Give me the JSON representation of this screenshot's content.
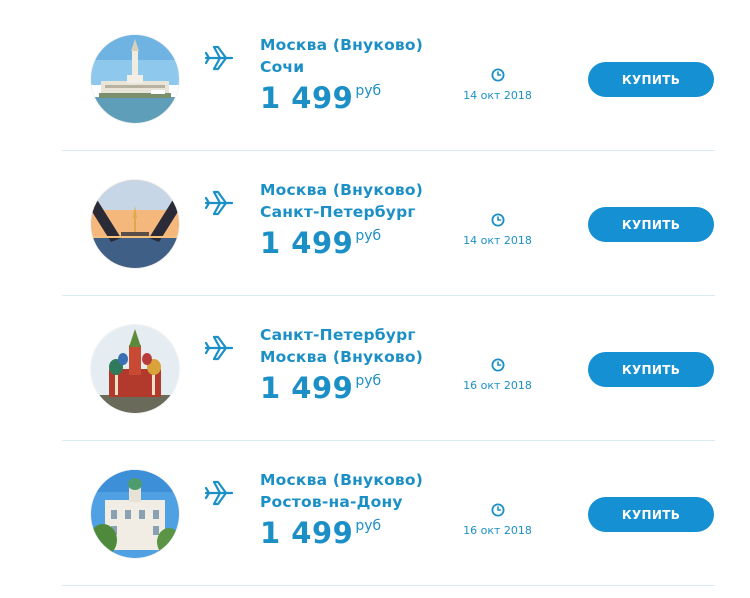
{
  "flights": [
    {
      "from": "Москва (Внуково)",
      "to": "Сочи",
      "price": "1 499",
      "currency": "руб",
      "date": "14 окт 2018",
      "buy_label": "КУПИТЬ",
      "photo": "sochi-seaport-photo"
    },
    {
      "from": "Москва (Внуково)",
      "to": "Санкт-Петербург",
      "price": "1 499",
      "currency": "руб",
      "date": "14 окт 2018",
      "buy_label": "КУПИТЬ",
      "photo": "saint-petersburg-bridge-photo"
    },
    {
      "from": "Санкт-Петербург",
      "to": "Москва (Внуково)",
      "price": "1 499",
      "currency": "руб",
      "date": "16 окт 2018",
      "buy_label": "КУПИТЬ",
      "photo": "moscow-st-basils-cathedral-photo"
    },
    {
      "from": "Москва (Внуково)",
      "to": "Ростов-на-Дону",
      "price": "1 499",
      "currency": "руб",
      "date": "16 окт 2018",
      "buy_label": "КУПИТЬ",
      "photo": "rostov-on-don-building-photo"
    }
  ],
  "colors": {
    "accent": "#1c90c6",
    "button": "#1590d2",
    "divider": "#d9ebf1"
  },
  "icons": {
    "route": "plane-icon",
    "date": "clock-icon"
  }
}
